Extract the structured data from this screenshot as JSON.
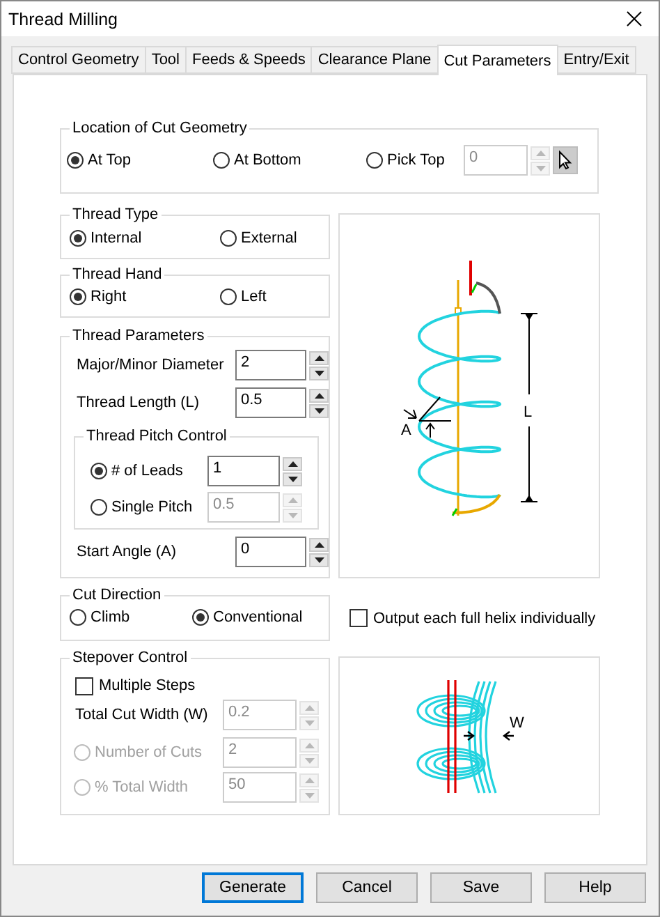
{
  "window": {
    "title": "Thread Milling"
  },
  "tabs": [
    {
      "label": "Control Geometry",
      "selected": false
    },
    {
      "label": "Tool",
      "selected": false
    },
    {
      "label": "Feeds & Speeds",
      "selected": false
    },
    {
      "label": "Clearance Plane",
      "selected": false
    },
    {
      "label": "Cut Parameters",
      "selected": true
    },
    {
      "label": "Entry/Exit",
      "selected": false
    }
  ],
  "location": {
    "title": "Location of Cut Geometry",
    "options": [
      {
        "label": "At Top",
        "selected": true
      },
      {
        "label": "At Bottom",
        "selected": false
      },
      {
        "label": "Pick Top",
        "selected": false
      }
    ],
    "pick_field": {
      "value": "0",
      "disabled": true
    }
  },
  "thread_type": {
    "title": "Thread Type",
    "options": [
      {
        "label": "Internal",
        "selected": true
      },
      {
        "label": "External",
        "selected": false
      }
    ]
  },
  "thread_hand": {
    "title": "Thread Hand",
    "options": [
      {
        "label": "Right",
        "selected": true
      },
      {
        "label": "Left",
        "selected": false
      }
    ]
  },
  "thread_parameters": {
    "title": "Thread Parameters",
    "fields": [
      {
        "label": "Major/Minor Diameter",
        "value": "2"
      },
      {
        "label": "Thread Length (L)",
        "value": "0.5"
      }
    ],
    "pitch_control": {
      "title": "Thread Pitch Control",
      "options": [
        {
          "label": "# of Leads",
          "selected": true,
          "value": "1",
          "field_disabled": false
        },
        {
          "label": "Single Pitch",
          "selected": false,
          "value": "0.5",
          "field_disabled": true
        }
      ]
    },
    "start_angle": {
      "label": "Start Angle (A)",
      "value": "0"
    }
  },
  "helix_diagram": {
    "angle_label": "A",
    "length_label": "L"
  },
  "cut_direction": {
    "title": "Cut Direction",
    "options": [
      {
        "label": "Climb",
        "selected": false
      },
      {
        "label": "Conventional",
        "selected": true
      }
    ]
  },
  "output_helix": {
    "label": "Output each full helix individually",
    "checked": false
  },
  "stepover": {
    "title": "Stepover Control",
    "multiple_steps": {
      "label": "Multiple Steps",
      "checked": false
    },
    "total_cut_width": {
      "label": "Total Cut Width (W)",
      "value": "0.2",
      "disabled": true
    },
    "options": [
      {
        "label": "Number of Cuts",
        "selected": false,
        "value": "2",
        "disabled": true
      },
      {
        "label": "% Total Width",
        "selected": false,
        "value": "50",
        "disabled": true
      }
    ]
  },
  "stepover_diagram": {
    "width_label": "W"
  },
  "buttons": [
    {
      "label": "Generate",
      "default": true
    },
    {
      "label": "Cancel",
      "default": false
    },
    {
      "label": "Save",
      "default": false
    },
    {
      "label": "Help",
      "default": false
    }
  ]
}
